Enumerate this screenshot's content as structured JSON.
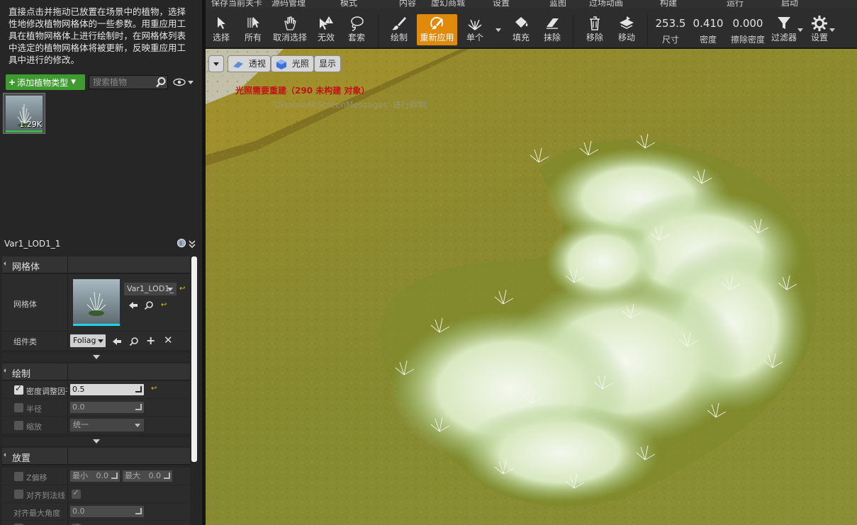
{
  "menubar": {
    "items": [
      "保存当前关卡",
      "源码管理",
      "模式",
      "内容",
      "虚幻商城",
      "设置",
      "蓝图",
      "过场动画",
      "构建",
      "运行",
      "启动"
    ]
  },
  "toolbar": {
    "select": "选择",
    "all": "所有",
    "deselect": "取消选择",
    "invalid": "无效",
    "lasso": "套索",
    "paint": "绘制",
    "reapply": "重新应用",
    "single": "单个",
    "fill": "填充",
    "erase": "抹除",
    "remove": "移除",
    "move": "移动",
    "size_value": "253.5",
    "size_label": "尺寸",
    "density_value": "0.410",
    "density_label": "密度",
    "erase_density_value": "0.000",
    "erase_density_label": "擦除密度",
    "filters": "过滤器",
    "settings": "设置"
  },
  "left_panel": {
    "help_text": "直接点击并拖动已放置在场景中的植物，选择性地修改植物网格体的一些参数。用重应用工具在植物网格体上进行绘制时，在网格体列表中选定的植物网格体将被更新，反映重应用工具中进行的修改。",
    "add_button": "添加植物类型",
    "search_placeholder": "搜索植物",
    "thumb_count": "1.29K",
    "details_title": "Var1_LOD1_1"
  },
  "details": {
    "mesh_category": "网格体",
    "mesh_label": "网格体",
    "mesh_value": "Var1_LOD1_",
    "component_label": "组件类",
    "component_value": "Foliag",
    "paint_category": "绘制",
    "density_label": "密度调整因子",
    "density_value": "0.5",
    "radius_label": "半径",
    "radius_value": "0.0",
    "scale_label": "缩放",
    "scale_value": "统一",
    "placement_category": "放置",
    "zoffset_label": "Z偏移",
    "min_label": "最小",
    "min_value": "0.0",
    "max_label": "最大",
    "max_value": "0.0",
    "align_normal_label": "对齐到法线",
    "align_max_angle_label": "对齐最大角度",
    "align_max_angle_value": "0.0"
  },
  "viewport": {
    "perspective": "透视",
    "lit": "光照",
    "show": "显示",
    "warning": "光照需要重建（290 未构建 对象）",
    "sub_message": "'DisableAllScreenMessages' 进行抑制"
  },
  "colors": {
    "accent": "#e08a0b",
    "add_green": "#3f9a2f",
    "warning_red": "#c11414"
  }
}
